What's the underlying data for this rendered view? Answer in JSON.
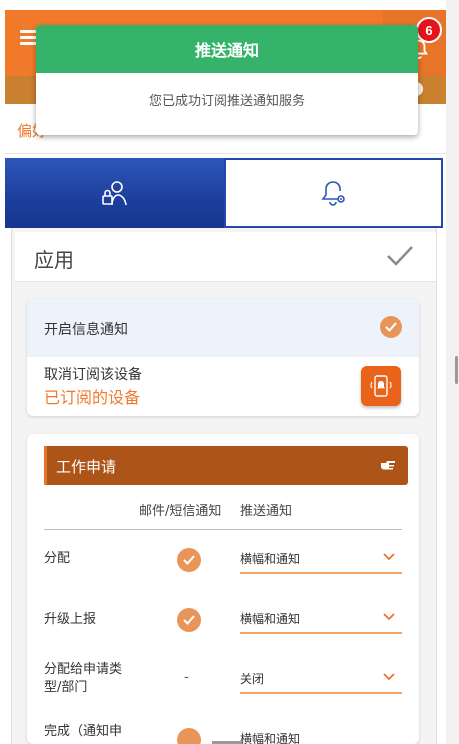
{
  "header": {
    "menu_icon": "hamburger-icon",
    "bell_icon": "bell-icon",
    "badge_count": "6",
    "brand_color": "#f07a2a"
  },
  "preference_bar": {
    "text": "偏好"
  },
  "toast": {
    "title": "推送通知",
    "message": "您已成功订阅推送通知服务",
    "color": "#35b36b"
  },
  "tabs": [
    {
      "icon": "user-lock-icon",
      "active": true
    },
    {
      "icon": "bell-settings-icon",
      "active": false
    }
  ],
  "apply": {
    "label": "应用",
    "icon": "checkmark-icon"
  },
  "notifications": {
    "enable_label": "开启信息通知",
    "enabled": true,
    "unsubscribe_label": "取消订阅该设备",
    "subscribed_label": "已订阅的设备",
    "device_icon": "phone-bell-icon"
  },
  "work_request": {
    "title": "工作申请",
    "header_icon": "pointing-hand-icon",
    "columns": [
      "邮件/短信通知",
      "推送通知"
    ],
    "rows": [
      {
        "label": "分配",
        "email_sms": "checked",
        "push": "横幅和通知"
      },
      {
        "label": "升级上报",
        "email_sms": "checked",
        "push": "横幅和通知"
      },
      {
        "label": "分配给申请类型/部门",
        "label_line1": "分配给申请类",
        "label_line2": "型/部门",
        "email_sms": "-",
        "push": "关闭"
      },
      {
        "label": "完成（通知申",
        "email_sms": "checked",
        "push": "横幅和通知"
      }
    ]
  }
}
